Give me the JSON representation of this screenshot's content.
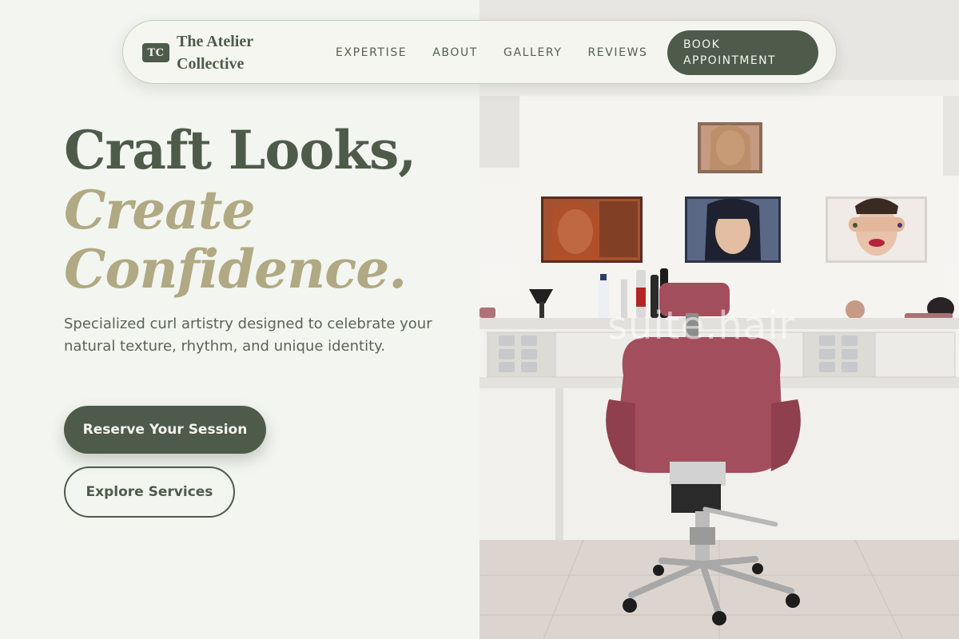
{
  "brand": {
    "badge": "TC",
    "name": "The Atelier Collective"
  },
  "nav": {
    "links": [
      "EXPERTISE",
      "ABOUT",
      "GALLERY",
      "REVIEWS"
    ],
    "cta": "BOOK APPOINTMENT"
  },
  "hero": {
    "headline_line1": "Craft Looks,",
    "headline_line2": "Create",
    "headline_line3": "Confidence.",
    "subtext": "Specialized curl artistry designed to celebrate your natural texture, rhythm, and unique identity.",
    "primary_button": "Reserve Your Session",
    "secondary_button": "Explore Services"
  },
  "photo": {
    "watermark": "suite.hair"
  },
  "colors": {
    "background": "#f3f5f0",
    "primary": "#4e5b4a",
    "accent": "#b0a983",
    "chair": "#a24e5c"
  }
}
